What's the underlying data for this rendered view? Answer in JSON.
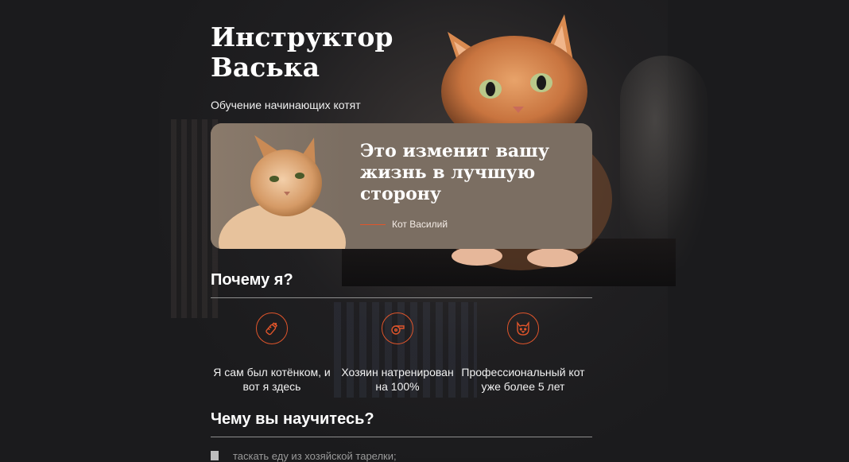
{
  "hero": {
    "title": "Инструктор Васька",
    "subtitle": "Обучение начинающих котят"
  },
  "quote": {
    "text": "Это изменит вашу жизнь в лучшую сторону",
    "author": "Кот Василий"
  },
  "why": {
    "heading": "Почему я?",
    "features": [
      {
        "icon": "baby-bottle-icon",
        "text": "Я сам был котёнком, и вот я здесь"
      },
      {
        "icon": "whistle-icon",
        "text": "Хозяин натренирован на 100%"
      },
      {
        "icon": "cat-face-icon",
        "text": "Профессиональный кот уже более 5 лет"
      }
    ]
  },
  "learn": {
    "heading": "Чему вы научитесь?",
    "items": [
      "таскать еду из хозяйской тарелки;"
    ]
  },
  "colors": {
    "background": "#1b1b1d",
    "accent": "#e0552b",
    "card": "#7b6e62"
  }
}
